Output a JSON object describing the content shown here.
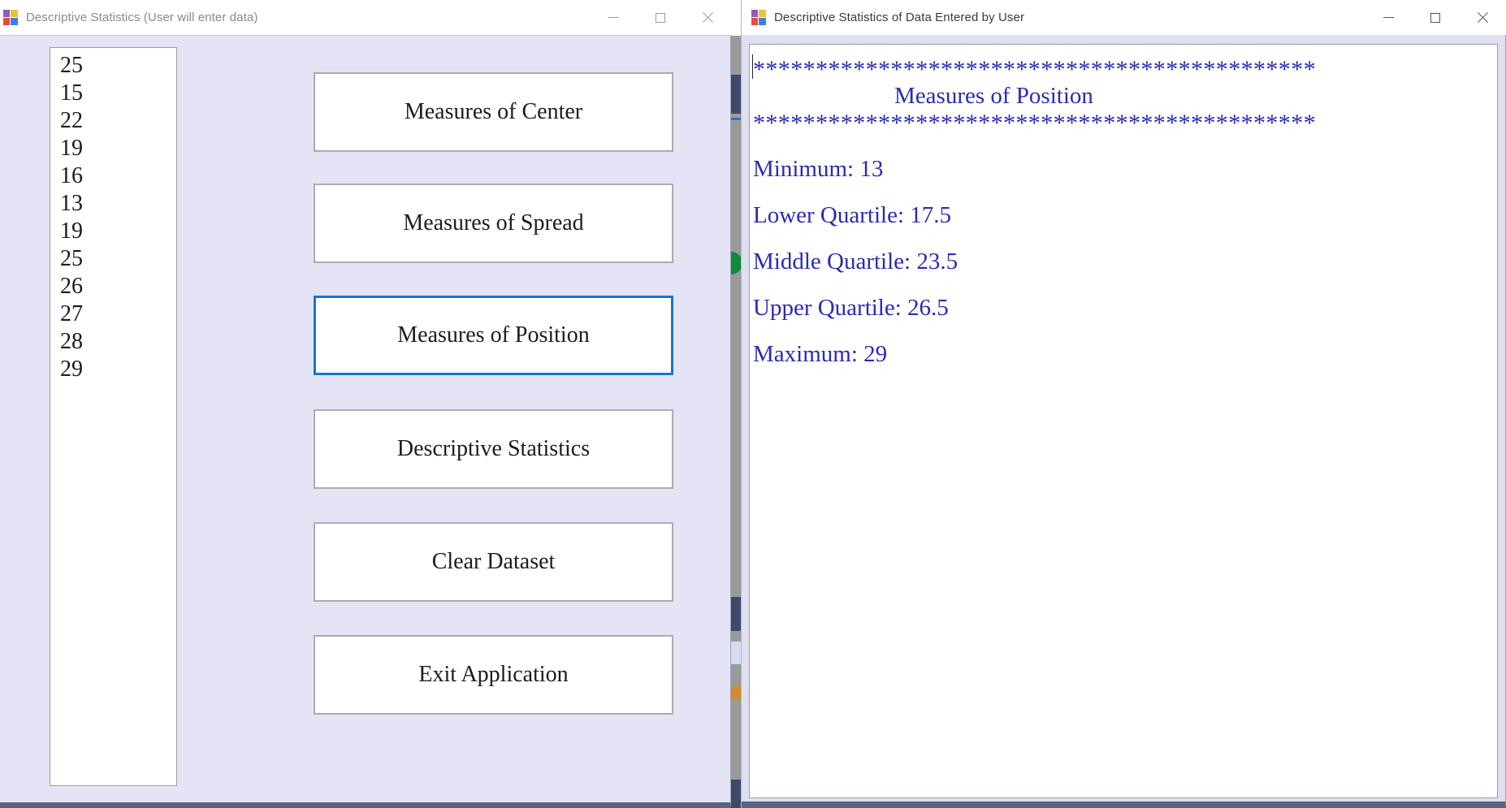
{
  "left_window": {
    "title": "Descriptive Statistics (User will enter data)",
    "icon": "vb-form-icon",
    "controls": {
      "minimize": "minimize-icon",
      "maximize": "maximize-icon",
      "close": "close-icon"
    },
    "dataset_listbox": {
      "name": "dataset-listbox",
      "values": [
        "25",
        "15",
        "22",
        "19",
        "16",
        "13",
        "19",
        "25",
        "26",
        "27",
        "28",
        "29"
      ]
    },
    "buttons": [
      {
        "label": "Measures of Center",
        "name": "measures-of-center-button",
        "focused": false
      },
      {
        "label": "Measures of Spread",
        "name": "measures-of-spread-button",
        "focused": false
      },
      {
        "label": "Measures of Position",
        "name": "measures-of-position-button",
        "focused": true
      },
      {
        "label": "Descriptive Statistics",
        "name": "descriptive-statistics-button",
        "focused": false
      },
      {
        "label": "Clear Dataset",
        "name": "clear-dataset-button",
        "focused": false
      },
      {
        "label": "Exit Application",
        "name": "exit-application-button",
        "focused": false
      }
    ],
    "focus_color": "#1575d0"
  },
  "right_window": {
    "title": "Descriptive Statistics of Data Entered by User",
    "icon": "vb-form-icon",
    "controls": {
      "minimize": "minimize-icon",
      "maximize": "maximize-icon",
      "close": "close-icon"
    },
    "output": {
      "name": "results-output",
      "text_color": "#2a2ab5",
      "rule_top": "*********************************************",
      "heading": "Measures of Position",
      "rule_bottom": "*********************************************",
      "lines": [
        {
          "label": "Minimum:",
          "value": "13",
          "text": "Minimum: 13"
        },
        {
          "label": "Lower Quartile:",
          "value": "17.5",
          "text": "Lower Quartile: 17.5"
        },
        {
          "label": "Middle Quartile:",
          "value": "23.5",
          "text": "Middle Quartile: 23.5"
        },
        {
          "label": "Upper Quartile:",
          "value": "26.5",
          "text": "Upper Quartile: 26.5"
        },
        {
          "label": "Maximum:",
          "value": "29",
          "text": "Maximum: 29"
        }
      ]
    }
  }
}
